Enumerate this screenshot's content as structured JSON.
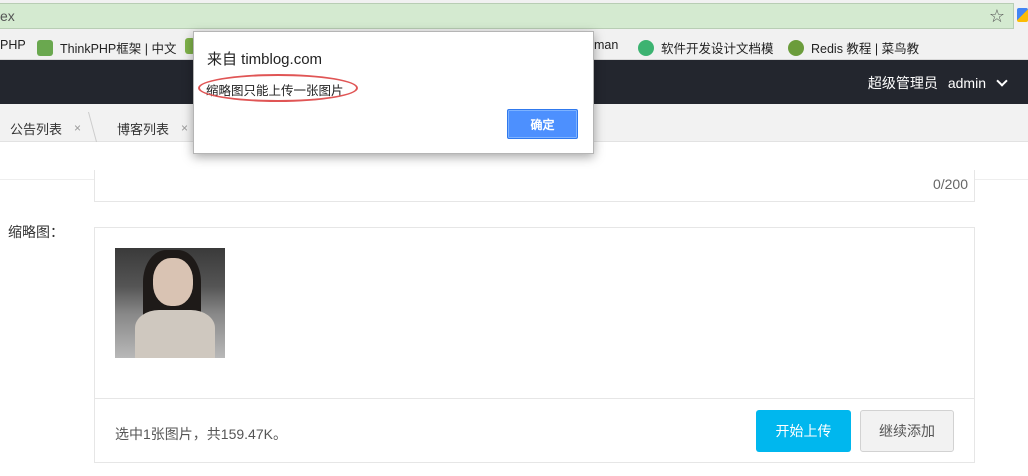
{
  "browser": {
    "omnibox_text": "ex",
    "bookmarks": [
      {
        "label": "PHP"
      },
      {
        "label": "ThinkPHP框架 | 中文"
      },
      {
        "label": "man"
      },
      {
        "label": "软件开发设计文档模"
      },
      {
        "label": "Redis 教程 | 菜鸟教"
      }
    ]
  },
  "header": {
    "role": "超级管理员",
    "username": "admin"
  },
  "tabs": [
    {
      "label": "公告列表",
      "close": "×"
    },
    {
      "label": "博客列表",
      "close": "×"
    }
  ],
  "form": {
    "counter": "0/200",
    "thumb_label": "缩略图：",
    "upload_status": "选中1张图片，共159.47K。",
    "start_upload": "开始上传",
    "continue_add": "继续添加"
  },
  "alert": {
    "title": "来自 timblog.com",
    "message": "缩略图只能上传一张图片",
    "ok_label": "确定"
  },
  "colors": {
    "header_bg": "#23262e",
    "primary_blue": "#00b7ee",
    "dialog_button": "#4d90fe",
    "highlight_oval": "#e05555"
  }
}
